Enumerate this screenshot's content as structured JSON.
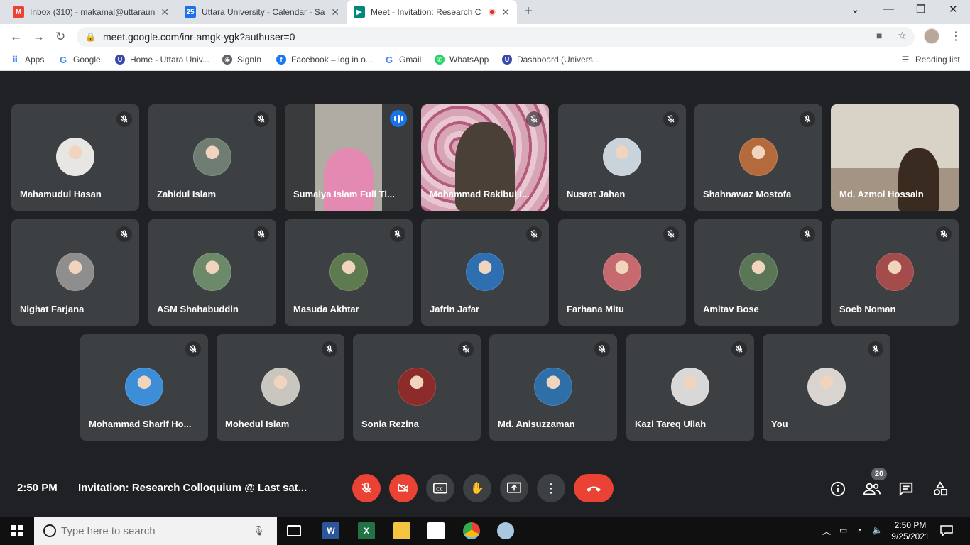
{
  "browser": {
    "tabs": [
      {
        "title": "Inbox (310) - makamal@uttaraun",
        "color": "#ea4335",
        "glyph": "M",
        "icon": "gmail-icon"
      },
      {
        "title": "Uttara University - Calendar - Sat",
        "color": "#1a73e8",
        "glyph": "25",
        "icon": "calendar-icon"
      },
      {
        "title": "Meet - Invitation: Research C",
        "color": "#00897b",
        "glyph": "",
        "icon": "meet-icon"
      }
    ],
    "url": "meet.google.com/inr-amgk-ygk?authuser=0",
    "bookmarks": [
      {
        "label": "Apps",
        "icon": "apps-grid-icon",
        "color": "#4285f4"
      },
      {
        "label": "Google",
        "icon": "google-icon",
        "color": "#4285f4"
      },
      {
        "label": "Home - Uttara Univ...",
        "icon": "uttara-icon",
        "color": "#3949ab"
      },
      {
        "label": "SignIn",
        "icon": "globe-icon",
        "color": "#5f6368"
      },
      {
        "label": "Facebook – log in o...",
        "icon": "facebook-icon",
        "color": "#1877f2"
      },
      {
        "label": "Gmail",
        "icon": "google-icon",
        "color": "#4285f4"
      },
      {
        "label": "WhatsApp",
        "icon": "whatsapp-icon",
        "color": "#25d366"
      },
      {
        "label": "Dashboard (Univers...",
        "icon": "uttara-icon",
        "color": "#3949ab"
      }
    ],
    "reading_list": "Reading list"
  },
  "meet": {
    "participants": [
      {
        "name": "Mahamudul Hasan",
        "avatar": "#e8e6e3",
        "muted": true
      },
      {
        "name": "Zahidul Islam",
        "avatar": "#6f7d72",
        "muted": true
      },
      {
        "name": "Sumaiya Islam Full Ti...",
        "video": true,
        "speaking": true
      },
      {
        "name": "Mohammad Rakibul I...",
        "video": true,
        "muted": true
      },
      {
        "name": "Nusrat Jahan",
        "avatar": "#c9d3dc",
        "muted": true
      },
      {
        "name": "Shahnawaz Mostofa",
        "avatar": "#b46a3c",
        "muted": true
      },
      {
        "name": "Md. Azmol Hossain",
        "video": true
      },
      {
        "name": "Nighat Farjana",
        "avatar": "#8e8e8e",
        "muted": true
      },
      {
        "name": "ASM Shahabuddin",
        "avatar": "#6c8a6a",
        "muted": true
      },
      {
        "name": "Masuda Akhtar",
        "avatar": "#5d7b4f",
        "muted": true
      },
      {
        "name": "Jafrin Jafar",
        "avatar": "#2d6fb0",
        "muted": true
      },
      {
        "name": "Farhana Mitu",
        "avatar": "#c76a6f",
        "muted": true
      },
      {
        "name": "Amitav Bose",
        "avatar": "#5b7657",
        "muted": true
      },
      {
        "name": "Soeb Noman",
        "avatar": "#a44b4b",
        "muted": true
      },
      {
        "name": "Mohammad Sharif Ho...",
        "avatar": "#3d8ed8",
        "muted": true
      },
      {
        "name": "Mohedul Islam",
        "avatar": "#c9c6c0",
        "muted": true
      },
      {
        "name": "Sonia Rezina",
        "avatar": "#8d2a2a",
        "muted": true
      },
      {
        "name": "Md. Anisuzzaman",
        "avatar": "#2f6fa8",
        "muted": true
      },
      {
        "name": "Kazi Tareq Ullah",
        "avatar": "#d8d8d8",
        "muted": true
      },
      {
        "name": "You",
        "avatar": "#d9d4cf",
        "muted": true
      }
    ],
    "time": "2:50 PM",
    "separator": "|",
    "meeting_title": "Invitation: Research Colloquium @ Last sat...",
    "participant_count": "20"
  },
  "taskbar": {
    "search_placeholder": "Type here to search",
    "time": "2:50 PM",
    "date": "9/25/2021"
  }
}
